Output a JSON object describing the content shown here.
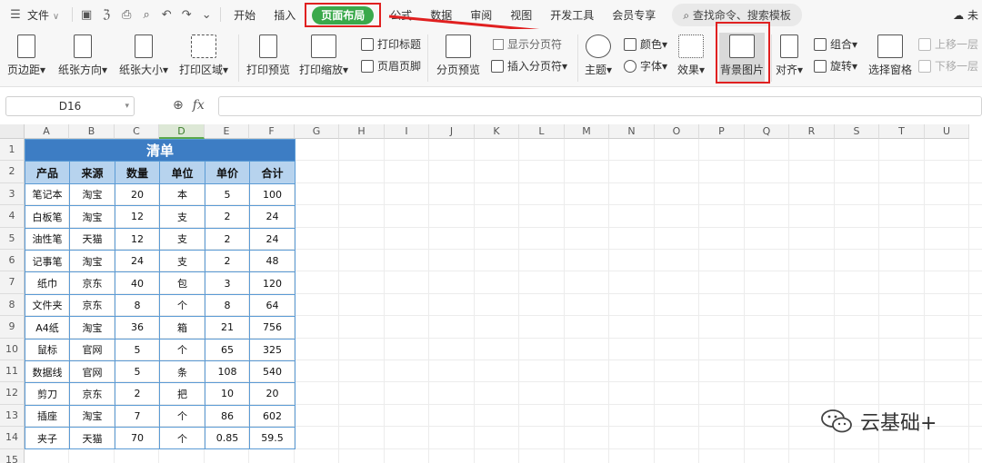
{
  "menubar": {
    "file_menu": "文件",
    "file_caret": "∨",
    "tabs": [
      "开始",
      "插入",
      "页面布局",
      "公式",
      "数据",
      "审阅",
      "视图",
      "开发工具",
      "会员专享"
    ],
    "search": "查找命令、搜索模板",
    "right_label": "未"
  },
  "ribbon": {
    "margins": "页边距",
    "orientation": "纸张方向",
    "size": "纸张大小",
    "print_area": "打印区域",
    "print_preview": "打印预览",
    "print_scale": "打印缩放",
    "print_titles": "打印标题",
    "header_footer": "页眉页脚",
    "page_break_preview": "分页预览",
    "show_page_breaks": "显示分页符",
    "insert_page_break": "插入分页符",
    "theme": "主题",
    "colors": "颜色",
    "fonts": "字体",
    "effects": "效果",
    "background_image": "背景图片",
    "align": "对齐",
    "group": "组合",
    "rotate": "旋转",
    "selection_pane": "选择窗格",
    "bring_forward": "上移一层",
    "send_backward": "下移一层"
  },
  "formula_bar": {
    "cell_ref": "D16",
    "fx_label": "fx"
  },
  "sheet": {
    "columns": [
      "A",
      "B",
      "C",
      "D",
      "E",
      "F",
      "G",
      "H",
      "I",
      "J",
      "K",
      "L",
      "M",
      "N",
      "O",
      "P",
      "Q",
      "R",
      "S",
      "T",
      "U"
    ],
    "selected_column": "D",
    "rows": [
      "1",
      "2",
      "3",
      "4",
      "5",
      "6",
      "7",
      "8",
      "9",
      "10",
      "11",
      "12",
      "13",
      "14",
      "15"
    ],
    "table_title": "清单",
    "headers": [
      "产品",
      "来源",
      "数量",
      "单位",
      "单价",
      "合计"
    ],
    "data": [
      [
        "笔记本",
        "淘宝",
        "20",
        "本",
        "5",
        "100"
      ],
      [
        "白板笔",
        "淘宝",
        "12",
        "支",
        "2",
        "24"
      ],
      [
        "油性笔",
        "天猫",
        "12",
        "支",
        "2",
        "24"
      ],
      [
        "记事笔",
        "淘宝",
        "24",
        "支",
        "2",
        "48"
      ],
      [
        "纸巾",
        "京东",
        "40",
        "包",
        "3",
        "120"
      ],
      [
        "文件夹",
        "京东",
        "8",
        "个",
        "8",
        "64"
      ],
      [
        "A4纸",
        "淘宝",
        "36",
        "箱",
        "21",
        "756"
      ],
      [
        "鼠标",
        "官网",
        "5",
        "个",
        "65",
        "325"
      ],
      [
        "数据线",
        "官网",
        "5",
        "条",
        "108",
        "540"
      ],
      [
        "剪刀",
        "京东",
        "2",
        "把",
        "10",
        "20"
      ],
      [
        "插座",
        "淘宝",
        "7",
        "个",
        "86",
        "602"
      ],
      [
        "夹子",
        "天猫",
        "70",
        "个",
        "0.85",
        "59.5"
      ]
    ]
  },
  "watermark": {
    "text": "云基础+"
  },
  "colors": {
    "accent_green": "#3aa94b",
    "title_blue": "#3d7dc4",
    "header_blue": "#b7d3ee",
    "highlight_red": "#e02020"
  }
}
